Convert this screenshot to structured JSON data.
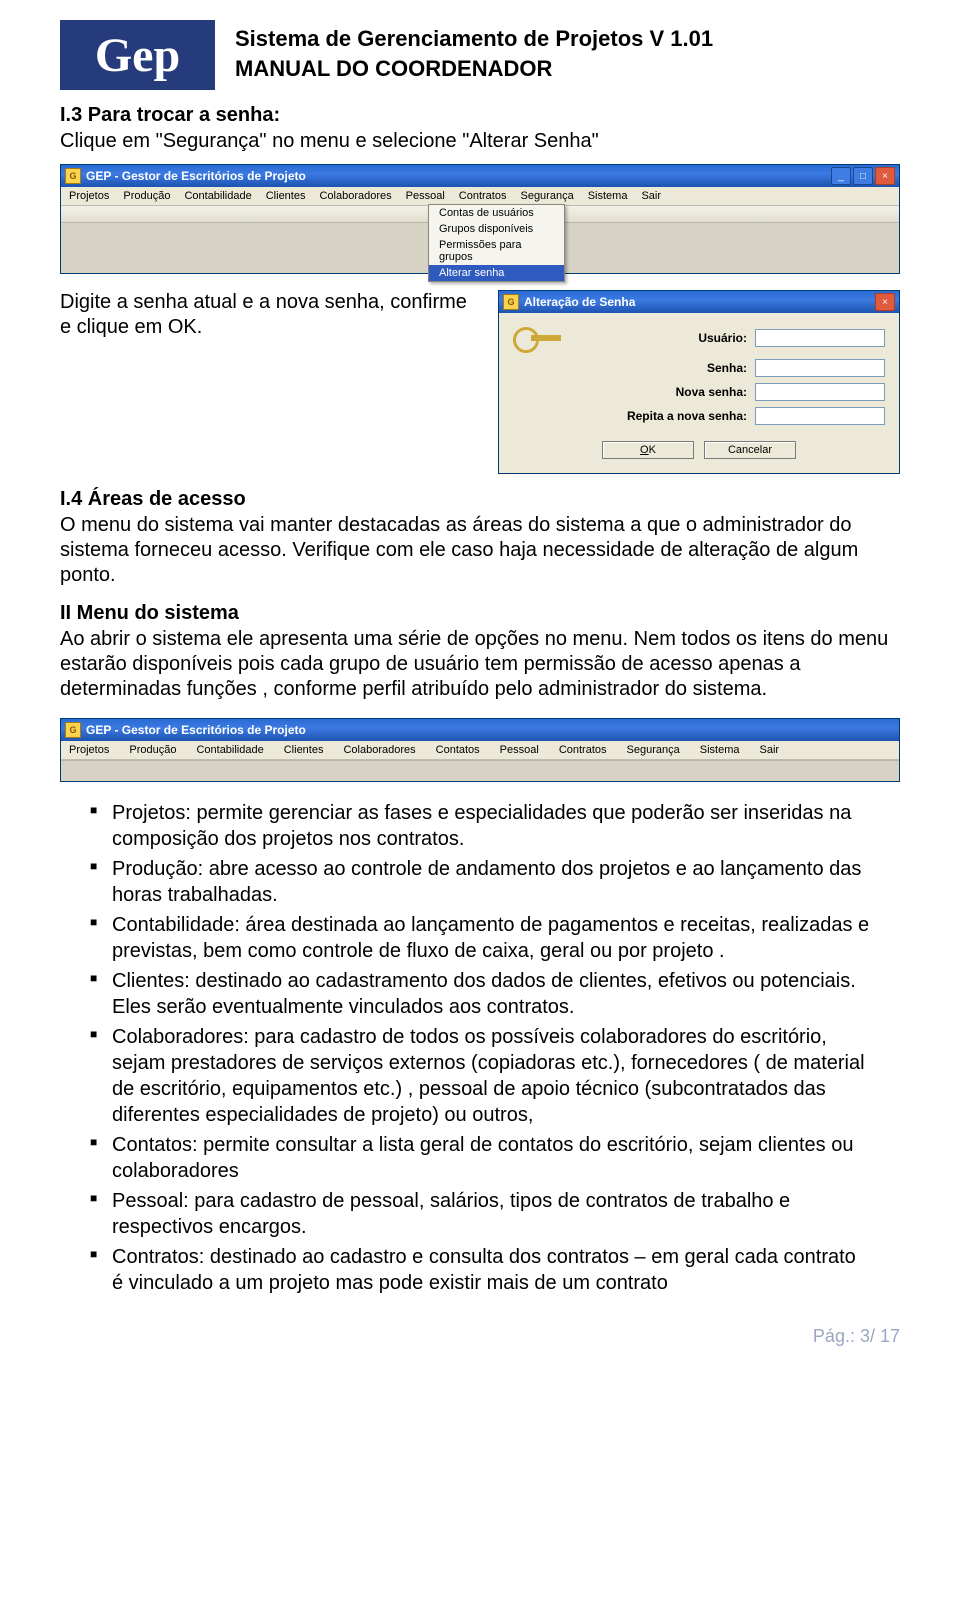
{
  "logo_text": "Gep",
  "header": {
    "line1": "Sistema de Gerenciamento de Projetos V 1.01",
    "line2": "MANUAL DO COORDENADOR"
  },
  "s13": {
    "title": "I.3   Para trocar a senha:",
    "line": "Clique em \"Segurança\" no menu e selecione \"Alterar Senha\""
  },
  "app": {
    "title": "GEP - Gestor de Escritórios de Projeto",
    "menu": [
      "Projetos",
      "Produção",
      "Contabilidade",
      "Clientes",
      "Colaboradores",
      "Pessoal",
      "Contratos",
      "Segurança",
      "Sistema",
      "Sair"
    ],
    "dropdown": [
      "Contas de usuários",
      "Grupos disponíveis",
      "Permissões para grupos",
      "Alterar senha"
    ]
  },
  "between_text": "Digite a senha atual e a nova senha, confirme e clique em OK.",
  "dialog": {
    "title": "Alteração de Senha",
    "fields": {
      "usuario": "Usuário:",
      "senha": "Senha:",
      "nova": "Nova senha:",
      "repita": "Repita a nova senha:"
    },
    "ok": "OK",
    "cancel": "Cancelar"
  },
  "s14": {
    "title": "I.4   Áreas de acesso",
    "para": "O menu do sistema vai manter destacadas as áreas do sistema a que o administrador do sistema forneceu acesso. Verifique com ele caso haja necessidade de alteração de algum ponto."
  },
  "s2": {
    "title": "II   Menu do sistema",
    "para": "Ao abrir o sistema ele apresenta uma série de opções no menu. Nem todos os itens do  menu estarão disponíveis pois cada grupo de usuário tem permissão de acesso apenas a determinadas funções , conforme perfil atribuído pelo administrador do sistema."
  },
  "app2": {
    "title": "GEP - Gestor de Escritórios de Projeto",
    "menu": [
      "Projetos",
      "Produção",
      "Contabilidade",
      "Clientes",
      "Colaboradores",
      "Contatos",
      "Pessoal",
      "Contratos",
      "Segurança",
      "Sistema",
      "Sair"
    ]
  },
  "bullets": [
    "Projetos: permite gerenciar as fases e especialidades que poderão ser inseridas na composição dos projetos nos contratos.",
    "Produção: abre acesso ao controle de andamento dos projetos e ao lançamento das horas trabalhadas.",
    "Contabilidade: área destinada ao lançamento de pagamentos e receitas, realizadas e previstas, bem como controle de fluxo de caixa, geral ou por projeto .",
    "Clientes: destinado ao cadastramento dos dados de clientes, efetivos ou potenciais. Eles serão eventualmente vinculados aos contratos.",
    "Colaboradores: para cadastro de todos os possíveis colaboradores do escritório, sejam prestadores de serviços externos (copiadoras etc.), fornecedores ( de material de escritório, equipamentos etc.) , pessoal de apoio técnico (subcontratados das diferentes especialidades de projeto) ou outros,",
    "Contatos: permite consultar a lista geral de contatos do escritório, sejam clientes ou colaboradores",
    "Pessoal: para cadastro de pessoal, salários, tipos de contratos de trabalho e respectivos encargos.",
    "Contratos: destinado ao cadastro  e consulta dos contratos – em geral cada contrato é vinculado a um projeto mas pode existir mais de um contrato"
  ],
  "footer": "Pág.: 3/ 17"
}
